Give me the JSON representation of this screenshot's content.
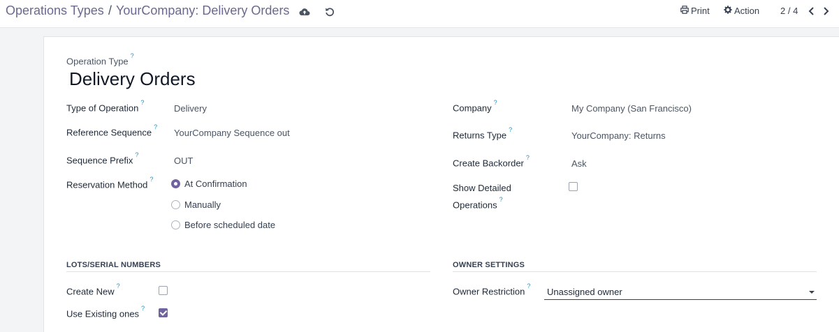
{
  "breadcrumb": {
    "parent": "Operations Types",
    "separator": "/",
    "current": "YourCompany: Delivery Orders"
  },
  "toolbar": {
    "save_icon": "cloud-upload-icon",
    "discard_icon": "undo-icon",
    "print_label": "Print",
    "print_icon": "printer-icon",
    "action_label": "Action",
    "action_icon": "gear-icon",
    "pager": "2 / 4"
  },
  "form": {
    "title_label": "Operation Type",
    "help": "?",
    "title_value": "Delivery Orders",
    "left": {
      "type_of_operation": {
        "label": "Type of Operation",
        "value": "Delivery"
      },
      "reference_sequence": {
        "label": "Reference Sequence",
        "value": "YourCompany Sequence out"
      },
      "sequence_prefix": {
        "label": "Sequence Prefix",
        "value": "OUT"
      },
      "reservation_method": {
        "label": "Reservation Method",
        "options": [
          "At Confirmation",
          "Manually",
          "Before scheduled date"
        ],
        "selected": "At Confirmation"
      }
    },
    "right": {
      "company": {
        "label": "Company",
        "value": "My Company (San Francisco)"
      },
      "returns_type": {
        "label": "Returns Type",
        "value": "YourCompany: Returns"
      },
      "create_backorder": {
        "label": "Create Backorder",
        "value": "Ask"
      },
      "show_detailed_operations": {
        "label_line1": "Show Detailed",
        "label_line2": "Operations",
        "checked": false
      }
    },
    "lots": {
      "title": "LOTS/SERIAL NUMBERS",
      "create_new": {
        "label": "Create New",
        "checked": false
      },
      "use_existing": {
        "label": "Use Existing ones",
        "checked": true
      }
    },
    "owner": {
      "title": "OWNER SETTINGS",
      "owner_restriction": {
        "label": "Owner Restriction",
        "value": "Unassigned owner"
      }
    }
  },
  "colors": {
    "accent": "#71639e",
    "breadcrumb": "#6b6990",
    "help": "#2b8fb8"
  }
}
